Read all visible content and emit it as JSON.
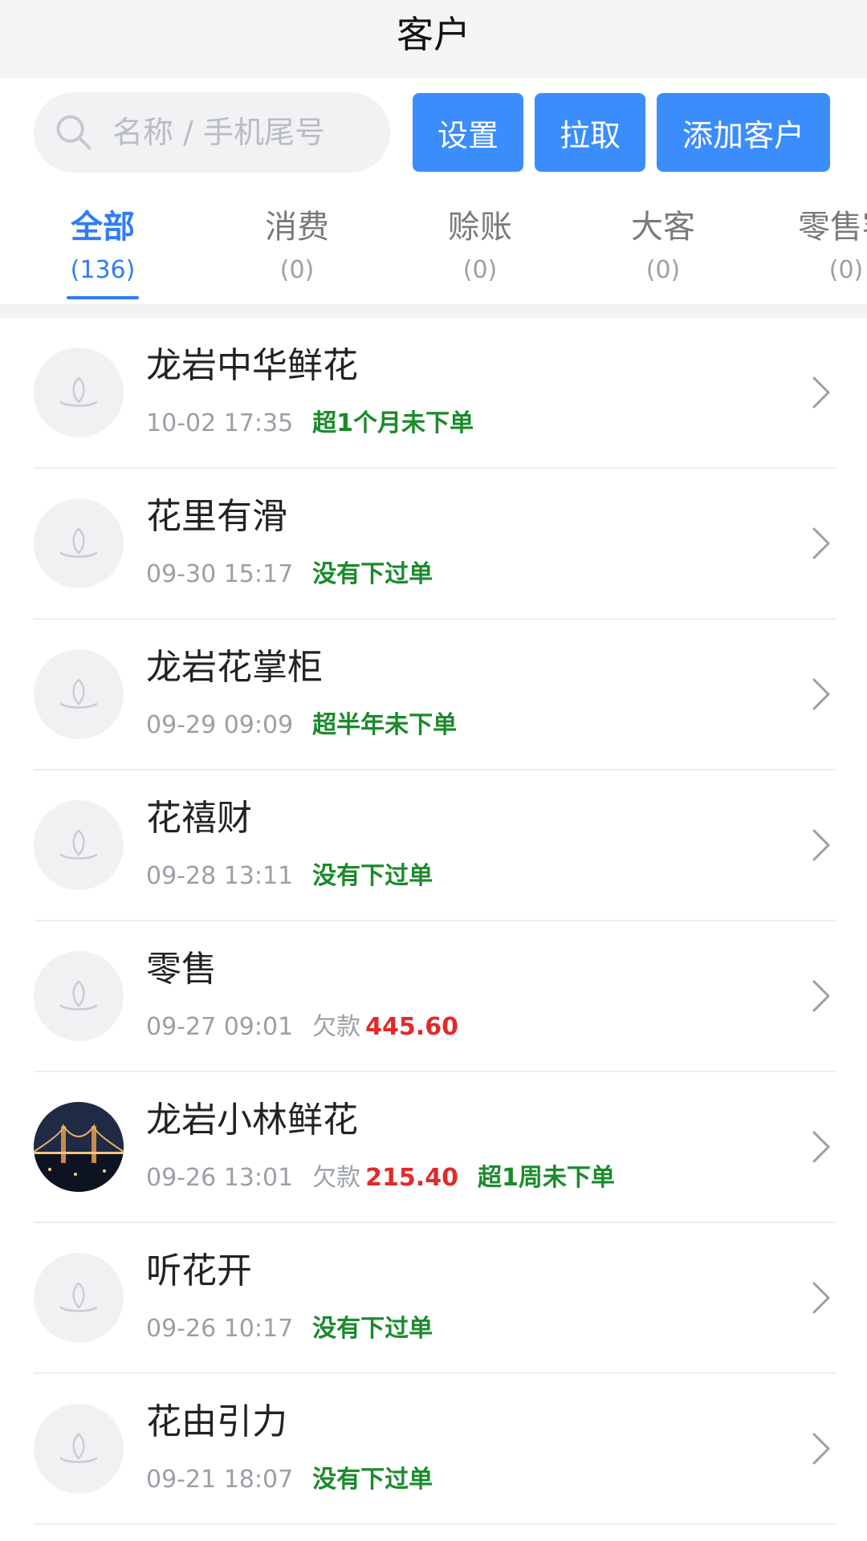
{
  "header": {
    "title": "客户"
  },
  "search": {
    "placeholder": "名称 / 手机尾号",
    "value": ""
  },
  "toolbar": {
    "settings_label": "设置",
    "pull_label": "拉取",
    "add_label": "添加客户"
  },
  "tabs": [
    {
      "label": "全部",
      "count": "(136)"
    },
    {
      "label": "消费",
      "count": "(0)"
    },
    {
      "label": "赊账",
      "count": "(0)"
    },
    {
      "label": "大客",
      "count": "(0)"
    },
    {
      "label": "零售客",
      "count": "(0)"
    }
  ],
  "customers": [
    {
      "name": "龙岩中华鲜花",
      "time": "10-02 17:35",
      "status": "超1个月未下单"
    },
    {
      "name": "花里有滑",
      "time": "09-30 15:17",
      "status": "没有下过单"
    },
    {
      "name": "龙岩花掌柜",
      "time": "09-29 09:09",
      "status": "超半年未下单"
    },
    {
      "name": "花禧财",
      "time": "09-28 13:11",
      "status": "没有下过单"
    },
    {
      "name": "零售",
      "time": "09-27 09:01",
      "debt_label": "欠款",
      "debt_amount": "445.60"
    },
    {
      "name": "龙岩小林鲜花",
      "time": "09-26 13:01",
      "debt_label": "欠款",
      "debt_amount": "215.40",
      "status": "超1周未下单"
    },
    {
      "name": "听花开",
      "time": "09-26 10:17",
      "status": "没有下过单"
    },
    {
      "name": "花由引力",
      "time": "09-21 18:07",
      "status": "没有下过单"
    }
  ],
  "colors": {
    "accent": "#3a8dfa",
    "status_green": "#1b8a2b",
    "debt_red": "#e02b2b"
  },
  "icons": {
    "search": "search-icon",
    "avatar_default": "default-avatar-icon",
    "row_arrow": "chevron-right-icon"
  }
}
